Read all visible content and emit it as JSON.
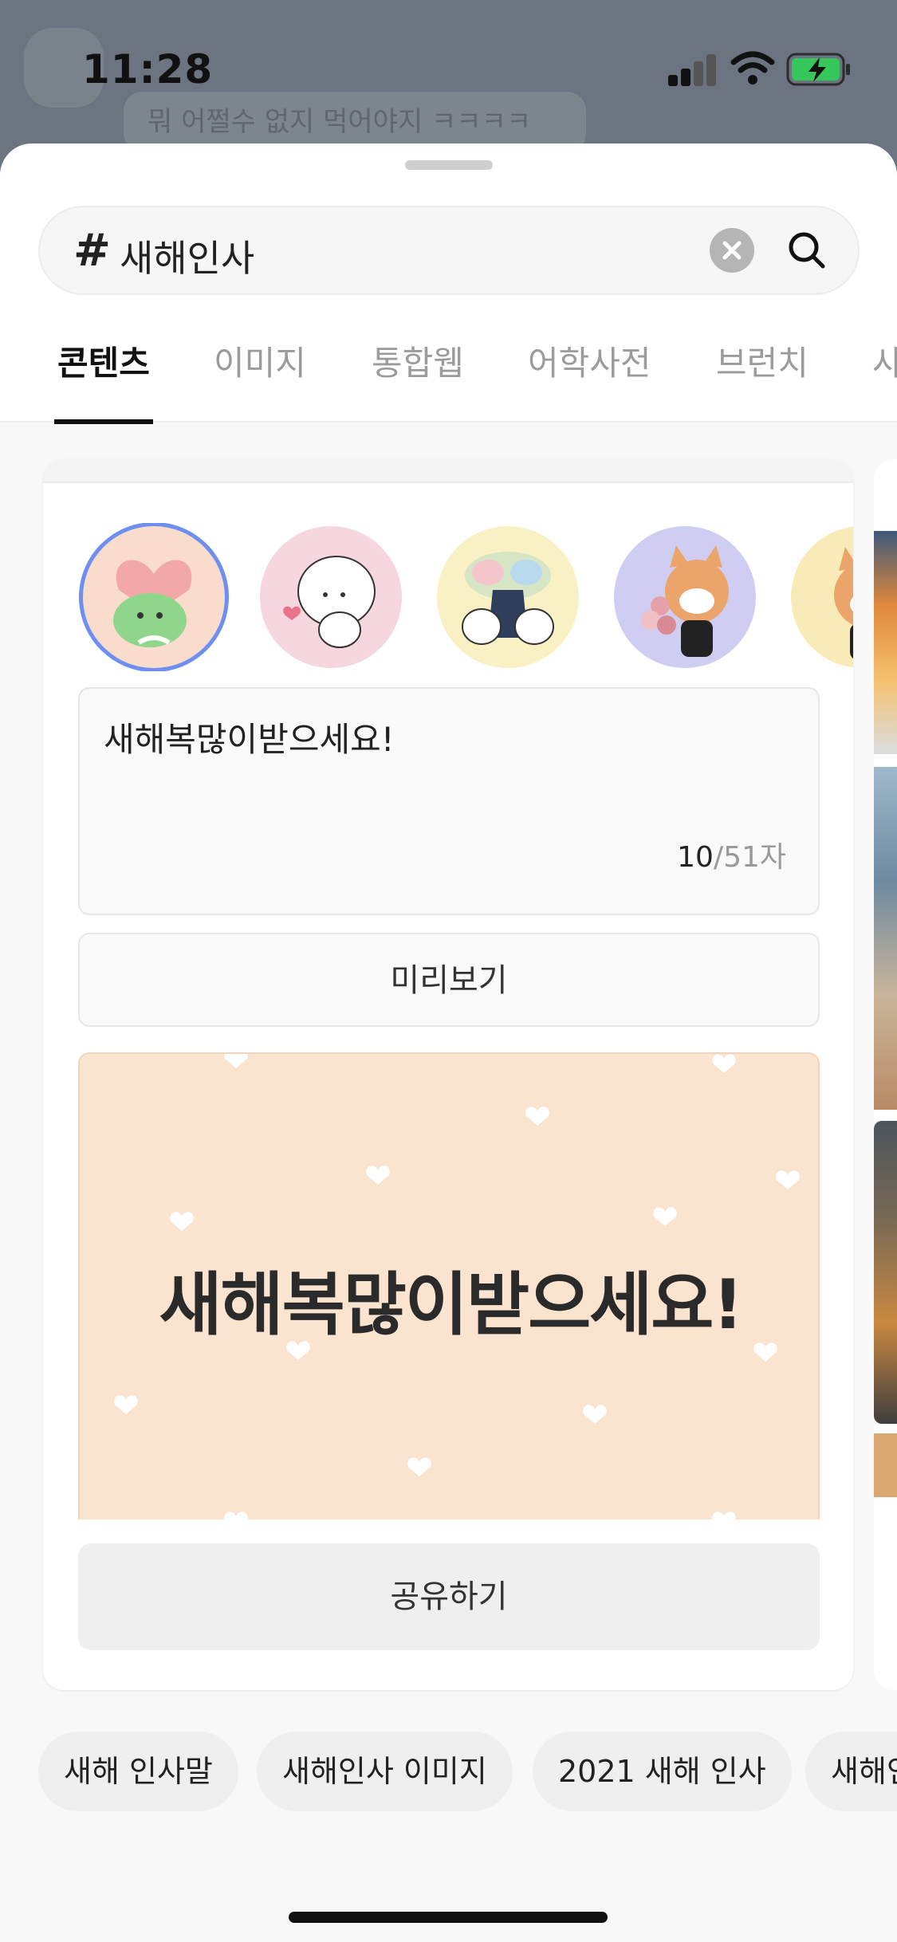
{
  "background": {
    "bubble_text": "뭐 어쩔수 없지 먹어야지 ㅋㅋㅋㅋ"
  },
  "status": {
    "time": "11:28",
    "icons": [
      "signal-icon",
      "wifi-icon",
      "battery-charging-icon"
    ]
  },
  "search": {
    "hash": "#",
    "query": "새해인사",
    "clear_icon": "clear-icon",
    "search_icon": "search-icon"
  },
  "tabs": [
    {
      "label": "콘텐츠",
      "active": true
    },
    {
      "label": "이미지"
    },
    {
      "label": "통합웹"
    },
    {
      "label": "어학사전"
    },
    {
      "label": "브런치"
    },
    {
      "label": "사"
    }
  ],
  "card": {
    "stickers": [
      {
        "name": "dino-heart-sticker",
        "bg": "#f9dccc",
        "selected": true
      },
      {
        "name": "white-seal-sticker",
        "bg": "#f6d6df"
      },
      {
        "name": "birds-hanbok-sticker",
        "bg": "#f9f1c4"
      },
      {
        "name": "red-panda-flowers-sticker",
        "bg": "#cfcdf1"
      },
      {
        "name": "red-panda-sticker",
        "bg": "#f9ebb8"
      }
    ],
    "message_text": "새해복많이받으세요!",
    "char_count": "10",
    "char_limit": "/51자",
    "preview_label": "미리보기",
    "preview_text": "새해복많이받으세요!",
    "preview_bg": "#fae4d0",
    "share_label": "공유하기"
  },
  "chips": [
    {
      "label": "새해 인사말"
    },
    {
      "label": "새해인사 이미지"
    },
    {
      "label": "2021 새해 인사"
    },
    {
      "label": "새해인"
    }
  ],
  "colors": {
    "accent_selected": "#6f8ff0",
    "sheet_bg": "#f8f8f8",
    "overlay": "#6b7480"
  }
}
